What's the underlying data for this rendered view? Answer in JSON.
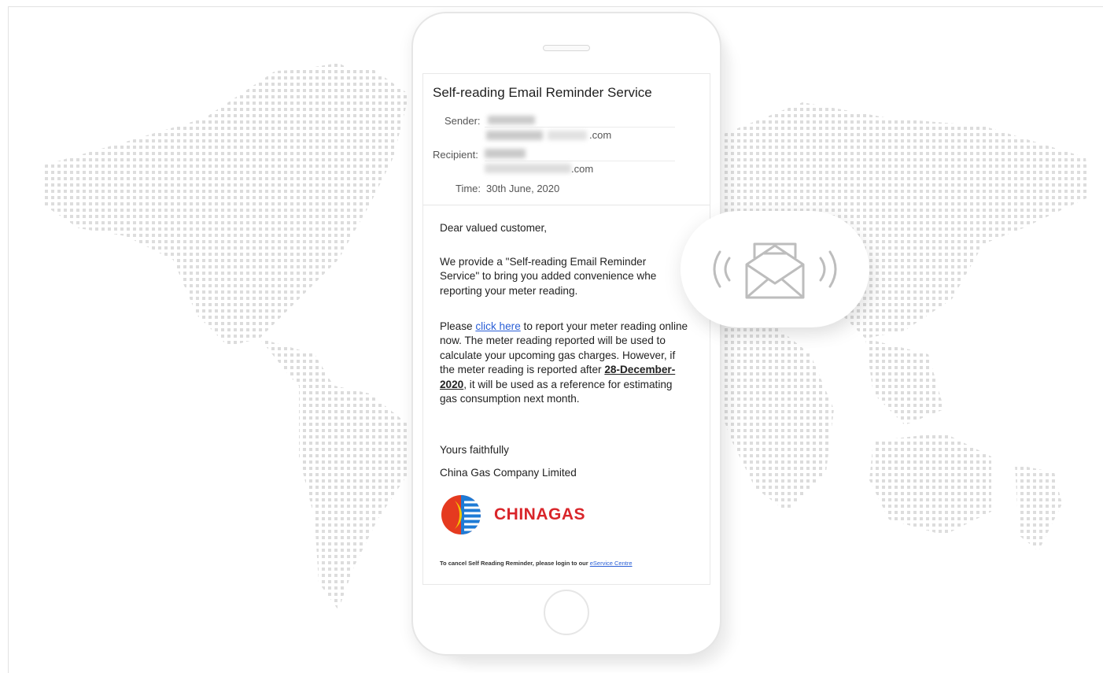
{
  "email": {
    "title": "Self-reading Email Reminder Service",
    "sender_label": "Sender:",
    "sender_domain": ".com",
    "recipient_label": "Recipient:",
    "recipient_domain": ".com",
    "time_label": "Time:",
    "time_value": "30th June, 2020",
    "greeting": "Dear valued customer,",
    "paragraph1": "We provide a \"Self-reading Email Reminder Service\" to bring you added convenience whe reporting your meter reading.",
    "p2_before_link": "Please ",
    "p2_link": "click here",
    "p2_after_link": " to report your meter reading online now. The meter reading reported will be used to calculate your upcoming gas charges. However, if the meter reading is reported after ",
    "p2_date": "28-December-2020",
    "p2_end": ", it will be used as a reference for estimating gas consumption next month.",
    "closing": "Yours faithfully",
    "company": "China Gas Company Limited",
    "logo_text": "CHINAGAS",
    "footer_text": "To cancel Self Reading Reminder, please login to our ",
    "footer_link": "eService Centre"
  },
  "icons": [
    "envelope-icon",
    "signal-waves-icon",
    "chinagas-logo-icon"
  ],
  "colors": {
    "link": "#2a5fd6",
    "brand_red": "#d9252a",
    "brand_blue": "#1e7bd6"
  }
}
